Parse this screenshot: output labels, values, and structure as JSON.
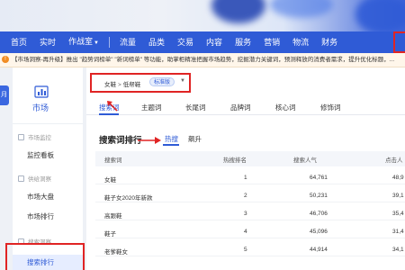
{
  "nav": {
    "items": [
      {
        "label": "首页"
      },
      {
        "label": "实时"
      },
      {
        "label": "作战室",
        "has_caret": true
      },
      {
        "label": "流量"
      },
      {
        "label": "品类"
      },
      {
        "label": "交易"
      },
      {
        "label": "内容"
      },
      {
        "label": "服务"
      },
      {
        "label": "营销"
      },
      {
        "label": "物流"
      },
      {
        "label": "财务"
      }
    ],
    "color": "#2f5bd6"
  },
  "notice": {
    "text": "【市场洞察-再升级】推出 \"趋势词榜单\" \"新词榜单\" 等功能，助掌柜精准把握市场趋势，挖掘潜力关键词，预测释放的消费者需求，提升优化标题，..."
  },
  "rail": {
    "label": "月"
  },
  "sidebar": {
    "title": "市场",
    "groups": [
      {
        "label": "市场监控",
        "items": [
          "监控看板"
        ]
      },
      {
        "label": "供给洞察",
        "items": [
          "市场大盘",
          "市场排行"
        ]
      },
      {
        "label": "搜索洞察",
        "items": [
          "搜索排行"
        ]
      }
    ],
    "active_item": "搜索排行"
  },
  "breadcrumb": {
    "parent": "女鞋",
    "sep": ">",
    "child": "低帮鞋",
    "badge": "标准版"
  },
  "tabs": [
    "搜索词",
    "主题词",
    "长尾词",
    "品牌词",
    "核心词",
    "修饰词"
  ],
  "active_tab": "搜索词",
  "section": {
    "title": "搜索词排行",
    "subtabs": [
      "热搜",
      "飙升"
    ],
    "active_subtab": "热搜"
  },
  "table": {
    "columns": [
      "搜索词",
      "热搜排名",
      "搜索人气",
      "点击人"
    ],
    "rows": [
      {
        "term": "女鞋",
        "rank": "1",
        "popularity": "64,761",
        "clicks": "48,9"
      },
      {
        "term": "鞋子女2020年新款",
        "rank": "2",
        "popularity": "50,231",
        "clicks": "39,1"
      },
      {
        "term": "高跟鞋",
        "rank": "3",
        "popularity": "46,706",
        "clicks": "35,4"
      },
      {
        "term": "鞋子",
        "rank": "4",
        "popularity": "45,096",
        "clicks": "31,4"
      },
      {
        "term": "老爹鞋女",
        "rank": "5",
        "popularity": "44,914",
        "clicks": "34,1"
      }
    ]
  }
}
